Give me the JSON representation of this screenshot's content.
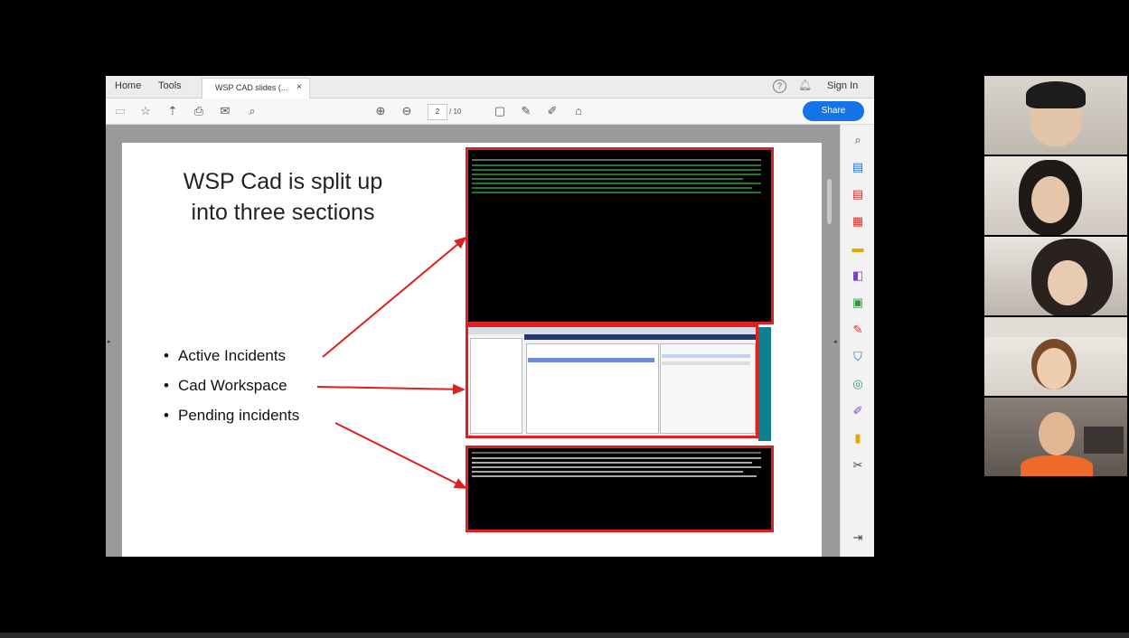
{
  "app": {
    "menu": [
      "Home",
      "Tools"
    ],
    "tab_label": "WSP CAD slides (...",
    "tab_close": "×",
    "sign_in": "Sign In",
    "share_label": "Share",
    "page_current": "2",
    "page_total": "/ 10"
  },
  "slide": {
    "title": "WSP Cad is split up into three sections",
    "bullets": [
      "Active Incidents",
      "Cad Workspace",
      "Pending incidents"
    ]
  },
  "colors": {
    "accent": "#1473e6",
    "highlight": "#e02020"
  }
}
